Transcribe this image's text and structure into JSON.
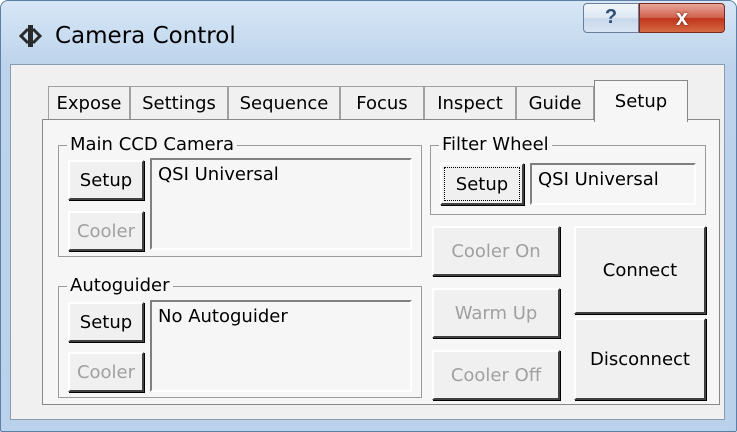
{
  "window": {
    "title": "Camera Control",
    "help_glyph": "?",
    "close_glyph": "x"
  },
  "tabs": [
    {
      "label": "Expose"
    },
    {
      "label": "Settings"
    },
    {
      "label": "Sequence"
    },
    {
      "label": "Focus"
    },
    {
      "label": "Inspect"
    },
    {
      "label": "Guide"
    },
    {
      "label": "Setup",
      "active": true
    }
  ],
  "main_camera": {
    "group_label": "Main CCD Camera",
    "setup_label": "Setup",
    "cooler_label": "Cooler",
    "camera_name": "QSI Universal"
  },
  "autoguider": {
    "group_label": "Autoguider",
    "setup_label": "Setup",
    "cooler_label": "Cooler",
    "camera_name": "No Autoguider"
  },
  "filter_wheel": {
    "group_label": "Filter Wheel",
    "setup_label": "Setup",
    "wheel_name": "QSI Universal"
  },
  "cooler_controls": {
    "cooler_on_label": "Cooler On",
    "warm_up_label": "Warm Up",
    "cooler_off_label": "Cooler Off"
  },
  "connection": {
    "connect_label": "Connect",
    "disconnect_label": "Disconnect"
  },
  "colors": {
    "title_bar": "#c7dbf0",
    "close_button": "#c2351c",
    "panel_background": "#f0f0f0",
    "disabled_text": "#a0a0a0"
  }
}
